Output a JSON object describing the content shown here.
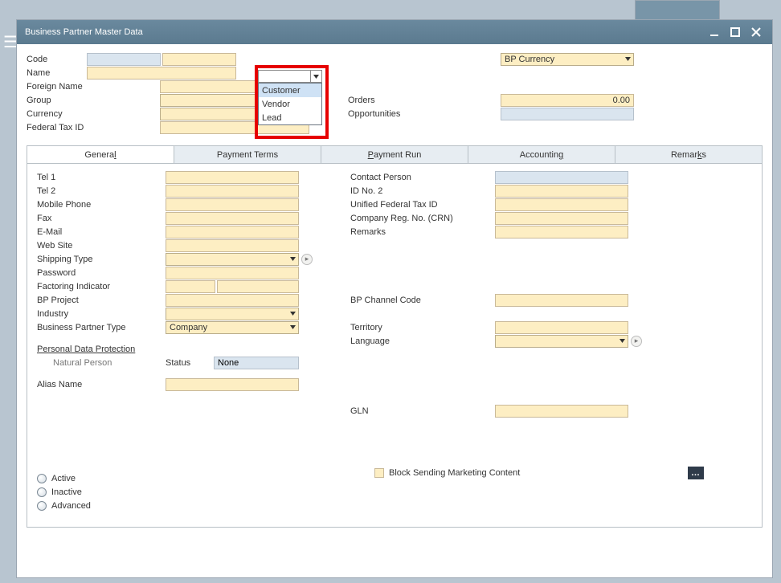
{
  "window": {
    "title": "Business Partner Master Data"
  },
  "header": {
    "left_labels": {
      "code": "Code",
      "name": "Name",
      "foreign_name": "Foreign Name",
      "group": "Group",
      "currency": "Currency",
      "federal_tax_id": "Federal Tax ID"
    },
    "right_labels": {
      "bp_currency": "BP Currency",
      "orders": "Orders",
      "opportunities": "Opportunities"
    },
    "orders_value": "0.00"
  },
  "code_type": {
    "selected": "",
    "options": [
      "Customer",
      "Vendor",
      "Lead"
    ]
  },
  "tabs": {
    "general": "General",
    "payment_terms": "Payment Terms",
    "payment_run": "Payment Run",
    "accounting": "Accounting",
    "remarks": "Remarks"
  },
  "general": {
    "left": {
      "tel1": "Tel 1",
      "tel2": "Tel 2",
      "mobile": "Mobile Phone",
      "fax": "Fax",
      "email": "E-Mail",
      "website": "Web Site",
      "shipping_type": "Shipping Type",
      "password": "Password",
      "factoring": "Factoring Indicator",
      "bp_project": "BP Project",
      "industry": "Industry",
      "bp_type": "Business Partner Type",
      "bp_type_value": "Company",
      "pdp": "Personal Data Protection",
      "natural_person": "Natural Person",
      "status": "Status",
      "status_value": "None",
      "alias": "Alias Name"
    },
    "right": {
      "contact": "Contact Person",
      "idno2": "ID No. 2",
      "uftid": "Unified Federal Tax ID",
      "crn": "Company Reg. No. (CRN)",
      "remarks": "Remarks",
      "bp_channel": "BP Channel Code",
      "territory": "Territory",
      "language": "Language",
      "gln": "GLN",
      "block_marketing": "Block Sending Marketing Content"
    },
    "radios": {
      "active": "Active",
      "inactive": "Inactive",
      "advanced": "Advanced"
    }
  }
}
